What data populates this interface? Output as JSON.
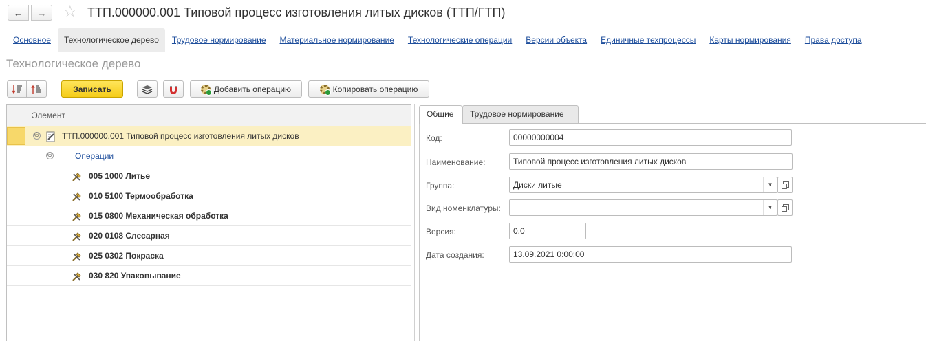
{
  "window": {
    "title": "ТТП.000000.001 Типовой процесс изготовления литых дисков (ТТП/ГТП)",
    "nav_back": "←",
    "nav_forward": "→",
    "favorite": "☆"
  },
  "tabs": [
    {
      "label": "Основное",
      "active": false
    },
    {
      "label": "Технологическое дерево",
      "active": true
    },
    {
      "label": "Трудовое нормирование",
      "active": false
    },
    {
      "label": "Материальное нормирование",
      "active": false
    },
    {
      "label": "Технологические операции",
      "active": false
    },
    {
      "label": "Версии объекта",
      "active": false
    },
    {
      "label": "Единичные техпроцессы",
      "active": false
    },
    {
      "label": "Карты нормирования",
      "active": false
    },
    {
      "label": "Права доступа",
      "active": false
    }
  ],
  "section": {
    "title": "Технологическое дерево"
  },
  "toolbar": {
    "save_label": "Записать",
    "add_operation_label": "Добавить операцию",
    "copy_operation_label": "Копировать операцию"
  },
  "tree": {
    "header": "Элемент",
    "root": "ТТП.000000.001 Типовой процесс изготовления литых дисков",
    "group": "Операции",
    "operations": [
      "005 1000 Литье",
      "010 5100 Термообработка",
      "015 0800 Механическая обработка",
      "020 0108 Слесарная",
      "025 0302 Покраска",
      "030 820 Упаковывание"
    ],
    "collapse_glyph": "⊖"
  },
  "details": {
    "tabs": {
      "general": "Общие",
      "labor": "Трудовое нормирование"
    },
    "fields": {
      "code_label": "Код:",
      "code_value": "00000000004",
      "name_label": "Наименование:",
      "name_value": "Типовой процесс изготовления литых дисков",
      "group_label": "Группа:",
      "group_value": "Диски литые",
      "nomenclature_label": "Вид номенклатуры:",
      "nomenclature_value": "",
      "version_label": "Версия:",
      "version_value": "0.0",
      "created_label": "Дата создания:",
      "created_value": "13.09.2021 0:00:00"
    },
    "dropdown_glyph": "▼"
  },
  "colors": {
    "link": "#1e4e9c",
    "save_button": "#f5cc18",
    "selected_row": "#fbf0c3"
  }
}
